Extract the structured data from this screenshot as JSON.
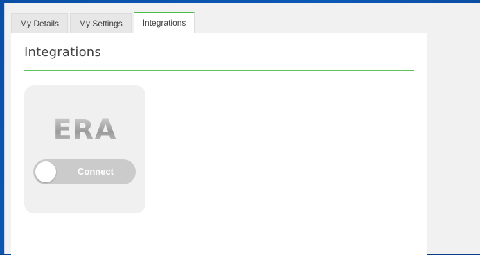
{
  "tabs": [
    {
      "label": "My Details",
      "active": false
    },
    {
      "label": "My Settings",
      "active": false
    },
    {
      "label": "Integrations",
      "active": true
    }
  ],
  "panel": {
    "title": "Integrations"
  },
  "integrations": [
    {
      "logo_text": "ERA",
      "toggle": {
        "label": "Connect",
        "on": false
      }
    }
  ],
  "colors": {
    "accent": "#4cbb4a",
    "toggle_off": "#cbcbcb",
    "card_bg": "#f0f0f0",
    "page_bg": "#f1f1f1"
  }
}
